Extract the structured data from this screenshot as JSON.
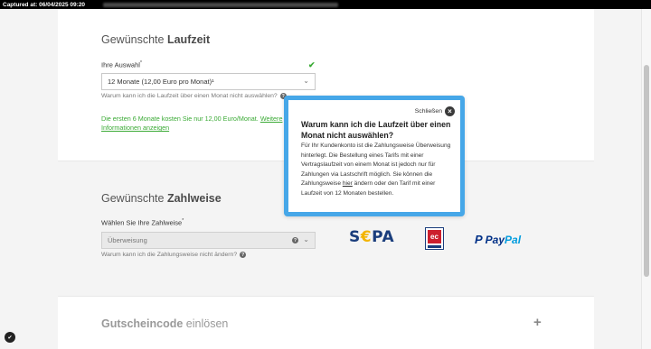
{
  "capture": {
    "label": "Captured at: 06/04/2025 09:20"
  },
  "laufzeit": {
    "heading_light": "Gewünschte",
    "heading_bold": "Laufzeit",
    "field_label": "Ihre Auswahl",
    "selected_value": "12 Monate (12,00 Euro pro Monat)¹",
    "help_text": "Warum kann ich die Laufzeit über einen Monat nicht auswählen?",
    "info_text": "Die ersten 6 Monate kosten Sie nur 12,00 Euro/Monat.",
    "info_link": "Weitere Informationen anzeigen"
  },
  "zahlweise": {
    "heading_light": "Gewünschte",
    "heading_bold": "Zahlweise",
    "field_label": "Wählen Sie Ihre Zahlweise",
    "selected_value": "Überweisung",
    "help_text": "Warum kann ich die Zahlungsweise nicht ändern?"
  },
  "payment_logos": {
    "sepa_1": "S",
    "sepa_e": "€",
    "sepa_2": "PA",
    "ec": "ec",
    "paypal_1": "Pay",
    "paypal_2": "Pal"
  },
  "gutschein": {
    "heading_bold": "Gutscheincode",
    "heading_light": "einlösen",
    "expand_symbol": "+"
  },
  "popup": {
    "close_label": "Schließen",
    "title": "Warum kann ich die Laufzeit über einen Monat nicht auswählen?",
    "body_1": "Für Ihr Kundenkonto ist die Zahlungsweise Überweisung hinterlegt. Die Bestellung eines Tarifs mit einer Vertragslaufzeit von einem Monat ist jedoch nur für Zahlungen via Lastschrift möglich. Sie können die Zahlungsweise ",
    "body_link": "hier",
    "body_2": " ändern oder den Tarif mit einer Laufzeit von 12 Monaten bestellen."
  },
  "colors": {
    "accent_green": "#3aaa35",
    "popup_border": "#46a7e8",
    "sepa_blue": "#1a3d7c",
    "paypal_dark": "#003087",
    "paypal_light": "#009cde"
  }
}
